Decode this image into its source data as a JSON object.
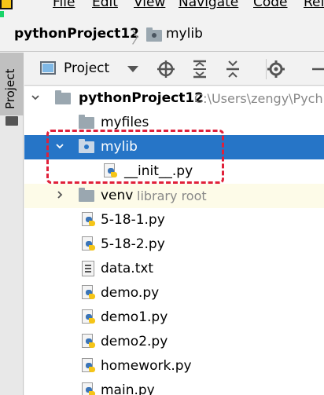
{
  "menubar": {
    "items": [
      "File",
      "Edit",
      "View",
      "Navigate",
      "Code",
      "Ref"
    ]
  },
  "breadcrumb": {
    "project": "pythonProject12",
    "folder": "mylib"
  },
  "side_tab": {
    "label": "Project"
  },
  "toolbar": {
    "view_label": "Project",
    "icons": [
      "target-icon",
      "expand-all-icon",
      "collapse-all-icon",
      "gear-icon"
    ]
  },
  "tree": {
    "root": {
      "name": "pythonProject12",
      "path": "C:\\Users\\zengy\\Pych"
    },
    "items": [
      {
        "name": "myfiles",
        "type": "folder"
      },
      {
        "name": "mylib",
        "type": "package",
        "selected": true
      },
      {
        "name": "__init__.py",
        "type": "python"
      },
      {
        "name": "venv",
        "type": "folder",
        "extra": "library root"
      },
      {
        "name": "5-18-1.py",
        "type": "python"
      },
      {
        "name": "5-18-2.py",
        "type": "python"
      },
      {
        "name": "data.txt",
        "type": "text"
      },
      {
        "name": "demo.py",
        "type": "python"
      },
      {
        "name": "demo1.py",
        "type": "python"
      },
      {
        "name": "demo2.py",
        "type": "python"
      },
      {
        "name": "homework.py",
        "type": "python"
      },
      {
        "name": "main.py",
        "type": "python"
      }
    ]
  },
  "colors": {
    "selection": "#2675c7",
    "library_row": "#fdfbe8",
    "annotation": "#e0203a",
    "accent_bar": "#19d469"
  }
}
